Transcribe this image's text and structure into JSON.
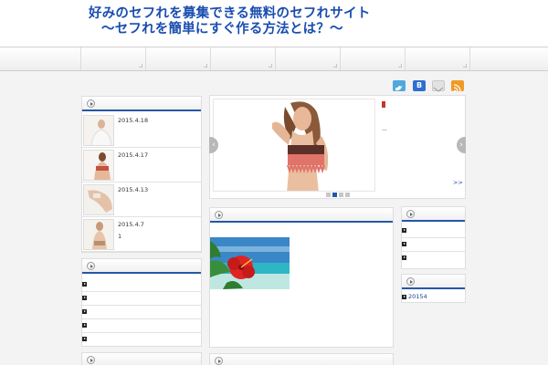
{
  "header": {
    "title_line1": "好みのセフれを募集できる無料のセフれサイト",
    "title_line2": "～セフれを簡単にすぐ作る方法とは？～",
    "title_color": "#1a4db0"
  },
  "share": [
    {
      "name": "twitter-share-icon",
      "color": "#4fa9dc"
    },
    {
      "name": "hatena-share-icon",
      "color": "#2f6fd0",
      "label": "B"
    },
    {
      "name": "mail-share-icon",
      "color": "#d9d9d9"
    },
    {
      "name": "rss-share-icon",
      "color": "#f09a26"
    }
  ],
  "posts": [
    {
      "date": "2015.4.18",
      "extra": ""
    },
    {
      "date": "2015.4.17",
      "extra": ""
    },
    {
      "date": "2015.4.13",
      "extra": ""
    },
    {
      "date": "2015.4.7",
      "extra": "1"
    }
  ],
  "slider": {
    "more_link": ">>",
    "dash": "—",
    "prev": "‹",
    "next": "›",
    "active_dot": 1
  },
  "archive": {
    "items": [
      "20154"
    ]
  },
  "accent_color": "#2458a6"
}
